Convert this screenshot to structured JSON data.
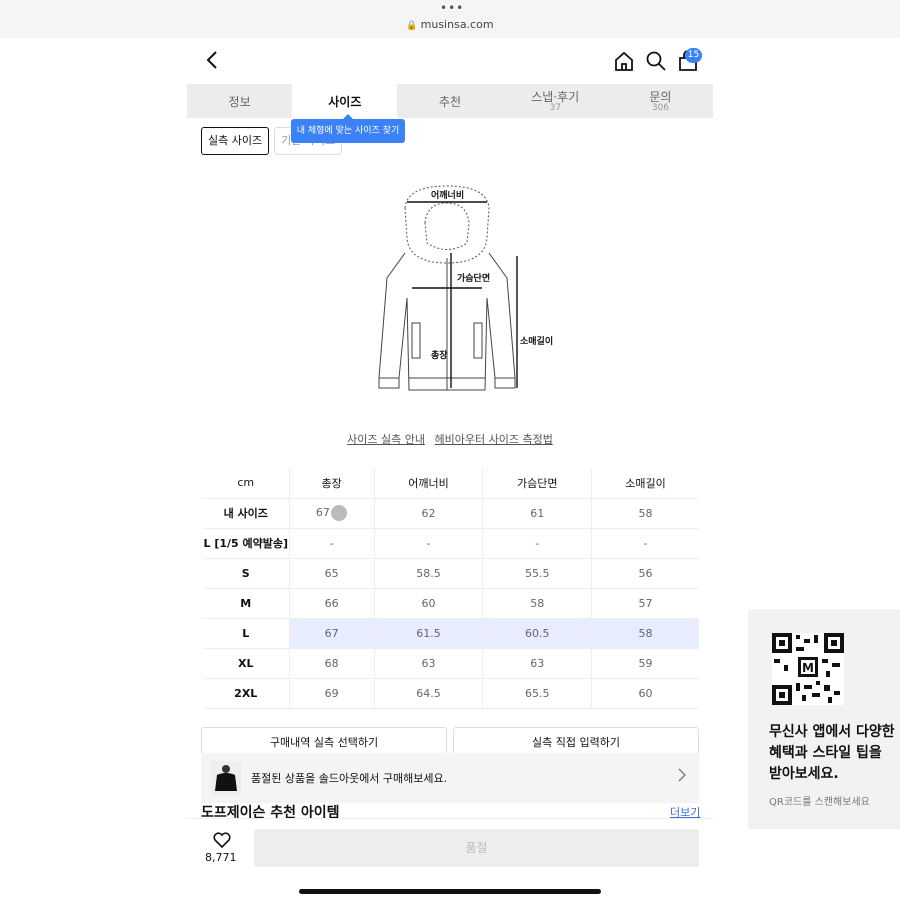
{
  "browser": {
    "url": "musinsa.com"
  },
  "header": {
    "cart_count": "15"
  },
  "tabs": [
    {
      "label": "정보",
      "count": ""
    },
    {
      "label": "사이즈",
      "count": ""
    },
    {
      "label": "추천",
      "count": ""
    },
    {
      "label": "스냅·후기",
      "count": "37"
    },
    {
      "label": "문의",
      "count": "306"
    }
  ],
  "tooltip": "내 체형에 맞는 사이즈 찾기",
  "subtabs": {
    "measured": "실측 사이즈",
    "basic": "기준 사이즈"
  },
  "diagram": {
    "shoulder": "어깨너비",
    "chest": "가슴단면",
    "length": "총장",
    "sleeve": "소매길이"
  },
  "links": {
    "guide": "사이즈 실측 안내",
    "method": "헤비아우터 사이즈 측정법"
  },
  "size_table": {
    "headers": [
      "cm",
      "총장",
      "어깨너비",
      "가슴단면",
      "소매길이"
    ],
    "rows": [
      {
        "name": "내 사이즈",
        "values": [
          "67",
          "62",
          "61",
          "58"
        ]
      },
      {
        "name": "L [1/5 예약발송]",
        "values": [
          "-",
          "-",
          "-",
          "-"
        ]
      },
      {
        "name": "S",
        "values": [
          "65",
          "58.5",
          "55.5",
          "56"
        ]
      },
      {
        "name": "M",
        "values": [
          "66",
          "60",
          "58",
          "57"
        ]
      },
      {
        "name": "L",
        "values": [
          "67",
          "61.5",
          "60.5",
          "58"
        ]
      },
      {
        "name": "XL",
        "values": [
          "68",
          "63",
          "63",
          "59"
        ]
      },
      {
        "name": "2XL",
        "values": [
          "69",
          "64.5",
          "65.5",
          "60"
        ]
      }
    ],
    "highlight_color": "#e8ecff"
  },
  "buttons": {
    "history": "구매내역 실측 선택하기",
    "manual": "실측 직접 입력하기"
  },
  "soldout_banner": "품절된 상품을 솔드아웃에서 구매해보세요.",
  "recommend": {
    "title": "도프제이슨 추천 아이템",
    "more": "더보기"
  },
  "bottom": {
    "likes": "8,771",
    "buy_label": "품절"
  },
  "qr_panel": {
    "line1": "무신사 앱에서 다양한",
    "line2": "혜택과 스타일 팁을",
    "line3": "받아보세요.",
    "caption": "QR코드를 스캔해보세요"
  },
  "accent_color": "#3b82f6"
}
